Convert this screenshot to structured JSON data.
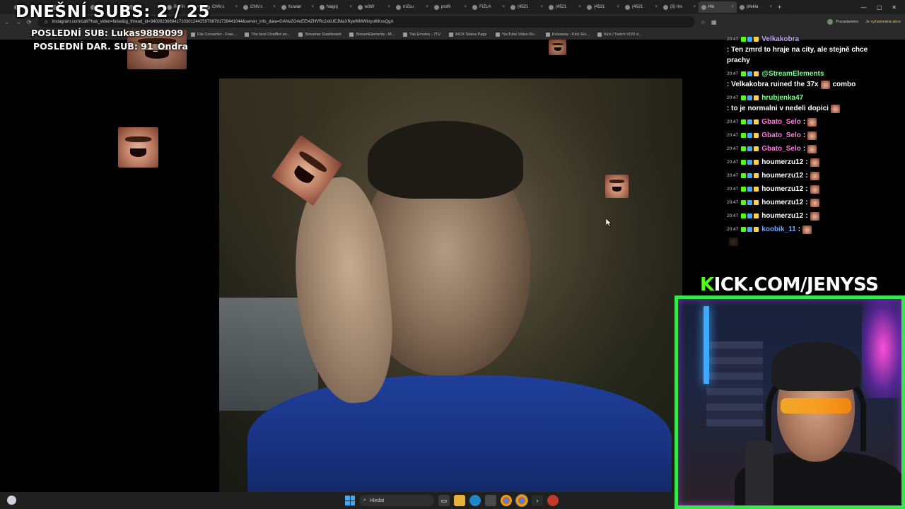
{
  "browser": {
    "tabs": [
      {
        "label": "",
        "active": false
      },
      {
        "label": "",
        "active": false
      },
      {
        "label": "",
        "active": false
      },
      {
        "label": "",
        "active": false
      },
      {
        "label": "Betfin",
        "active": false
      },
      {
        "label": "ChIV.c",
        "active": false
      },
      {
        "label": "ChIV.c",
        "active": false
      },
      {
        "label": "Kuwan",
        "active": false
      },
      {
        "label": "Nagoj",
        "active": false
      },
      {
        "label": "w3W",
        "active": false
      },
      {
        "label": "mZsu",
        "active": false
      },
      {
        "label": "profil",
        "active": false
      },
      {
        "label": "FIZLA",
        "active": false
      },
      {
        "label": "(4521",
        "active": false
      },
      {
        "label": "(4521",
        "active": false
      },
      {
        "label": "(4521",
        "active": false
      },
      {
        "label": "(4521",
        "active": false
      },
      {
        "label": "(5) Ins",
        "active": false
      },
      {
        "label": "Ho",
        "active": true
      },
      {
        "label": "překla",
        "active": false
      }
    ],
    "url": "instagram.com/call/?has_video=false&ig_thread_id=340282366841710301244259798791739441044&server_info_data=GANvZG4oEEt4ZHVRc2xkUEJMaXRyeWMWkryul6KxsQgA",
    "profile_label": "Pozastaveno",
    "update_label": "Je vyžadována akce",
    "bookmarks": [
      "File Converter - Free...",
      "The best ChatBot an...",
      "Streamer Dashboard",
      "StreamElements - M...",
      "Top Emotes - 7TV",
      "KICK Status Page",
      "YouTube Video Do...",
      "Kickaway - Kick Giv...",
      "Kick / Twitch VOD d..."
    ]
  },
  "overlay": {
    "subs_today": "DNEŠNÍ SUBS: 2 / 25",
    "last_sub": "POSLEDNÍ SUB: Lukas9889099",
    "last_donated_sub": "POSLEDNÍ DAR. SUB: 91_Ondra",
    "kick_url_k": "K",
    "kick_url_rest": "ICK.COM/JENYSS"
  },
  "chat": {
    "messages": [
      {
        "time": "20:47",
        "user": "Velkakobra",
        "user_color": "#c8a6ff",
        "text": ": Ten zmrd to hraje na city, ale stejně chce prachy",
        "emote": false
      },
      {
        "time": "20:47",
        "user": "@StreamElements",
        "user_color": "#7cff8c",
        "text": ": Velkakobra ruined the 37x",
        "emote": true,
        "after_emote": "combo"
      },
      {
        "time": "20:47",
        "user": "hrubjenka47",
        "user_color": "#7cff8c",
        "text": ": to je normalni v nedeli dopici",
        "emote": true
      },
      {
        "time": "20:47",
        "user": "Gbato_Selo",
        "user_color": "#ff7ad9",
        "text": ":",
        "emote": true
      },
      {
        "time": "20:47",
        "user": "Gbato_Selo",
        "user_color": "#ff7ad9",
        "text": ":",
        "emote": true
      },
      {
        "time": "20:47",
        "user": "Gbato_Selo",
        "user_color": "#ff7ad9",
        "text": ":",
        "emote": true
      },
      {
        "time": "20:47",
        "user": "houmerzu12",
        "user_color": "#ffffff",
        "text": ":",
        "emote": true
      },
      {
        "time": "20:47",
        "user": "houmerzu12",
        "user_color": "#ffffff",
        "text": ":",
        "emote": true
      },
      {
        "time": "20:47",
        "user": "houmerzu12",
        "user_color": "#ffffff",
        "text": ":",
        "emote": true
      },
      {
        "time": "20:47",
        "user": "houmerzu12",
        "user_color": "#ffffff",
        "text": ":",
        "emote": true
      },
      {
        "time": "20:47",
        "user": "houmerzu12",
        "user_color": "#ffffff",
        "text": ":",
        "emote": true
      },
      {
        "time": "20:47",
        "user": "koobik_11",
        "user_color": "#6fa8ff",
        "text": ":",
        "emote": true
      }
    ]
  },
  "taskbar": {
    "search_placeholder": "Hledat"
  },
  "colors": {
    "kick_green": "#53fc18",
    "cam_border": "#38e84a"
  }
}
